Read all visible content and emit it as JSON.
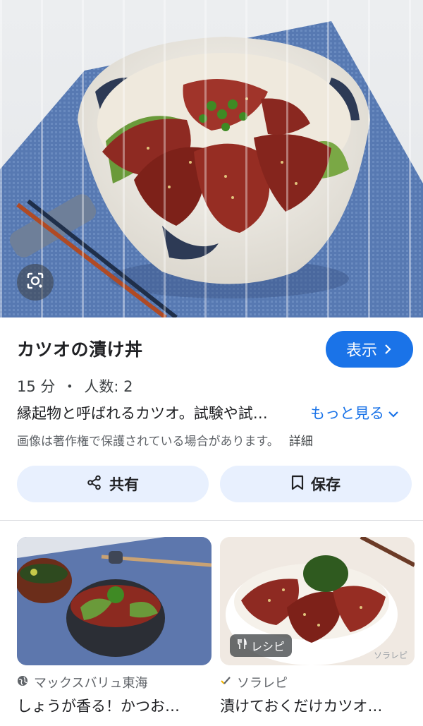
{
  "dish": {
    "title": "カツオの漬け丼",
    "time": "15 分",
    "separator": "・",
    "servings": "人数: 2",
    "description": "縁起物と呼ばれるカツオ。試験や試…",
    "more_label": "もっと見る",
    "show_label": "表示",
    "copyright_note": "画像は著作権で保護されている場合があります。",
    "details_label": "詳細"
  },
  "actions": {
    "share_label": "共有",
    "save_label": "保存"
  },
  "related": [
    {
      "source": "マックスバリュ東海",
      "source_icon": "globe-icon",
      "title": "しょうが香る！かつお…"
    },
    {
      "source": "ソラレピ",
      "source_icon": "check-mark-icon",
      "title": "漬けておくだけカツオ…",
      "badge": "レシピ",
      "badge_icon": "fork-knife-icon",
      "watermark": "ソラレピ"
    }
  ],
  "colors": {
    "accent": "#1a73e8",
    "chip_bg": "#e8f0fe",
    "text": "#202124",
    "muted": "#5f6368"
  }
}
